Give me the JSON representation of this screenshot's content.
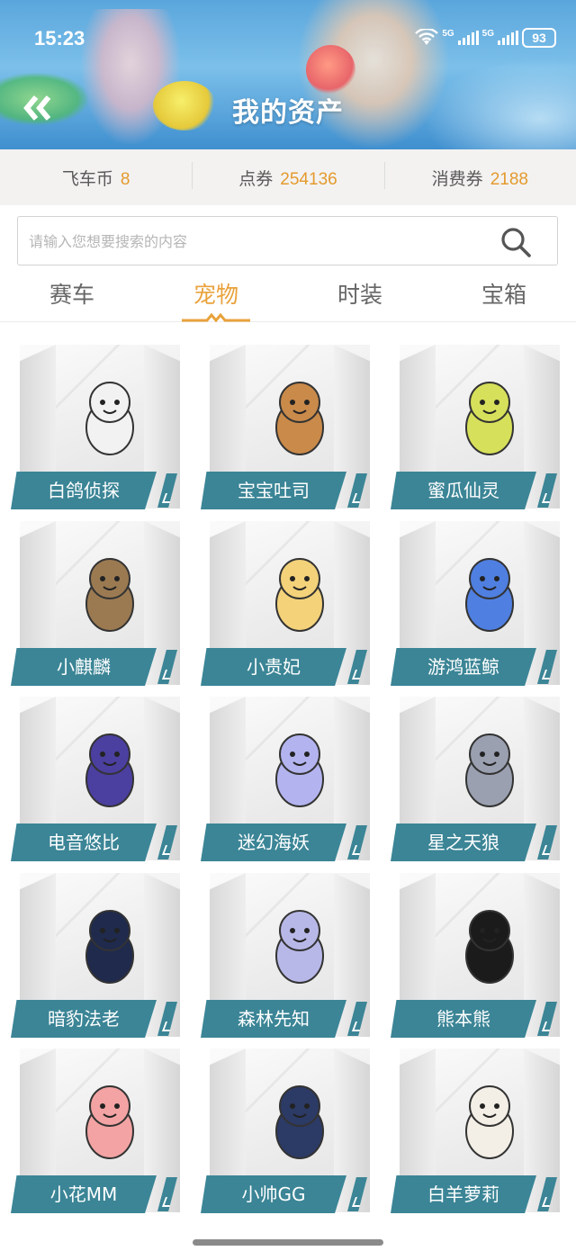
{
  "status_bar": {
    "time": "15:23",
    "network_1": "5G",
    "network_2": "5G",
    "battery": "93"
  },
  "header": {
    "title": "我的资产"
  },
  "balances": [
    {
      "label": "飞车币",
      "value": "8"
    },
    {
      "label": "点券",
      "value": "254136"
    },
    {
      "label": "消费券",
      "value": "2188"
    }
  ],
  "search": {
    "placeholder": "请输入您想要搜索的内容",
    "value": ""
  },
  "tabs": [
    {
      "label": "赛车",
      "active": false
    },
    {
      "label": "宠物",
      "active": true
    },
    {
      "label": "时装",
      "active": false
    },
    {
      "label": "宝箱",
      "active": false
    }
  ],
  "pets": [
    {
      "name": "白鸽侦探",
      "icon": "pigeon-detective-icon",
      "color": "#f2f2f2"
    },
    {
      "name": "宝宝吐司",
      "icon": "toast-cookie-icon",
      "color": "#c98a4a"
    },
    {
      "name": "蜜瓜仙灵",
      "icon": "melon-fairy-icon",
      "color": "#d7e05a"
    },
    {
      "name": "小麒麟",
      "icon": "qilin-icon",
      "color": "#9b7a52"
    },
    {
      "name": "小贵妃",
      "icon": "princess-icon",
      "color": "#f3d27a"
    },
    {
      "name": "游鸿蓝鲸",
      "icon": "blue-whale-icon",
      "color": "#4f7fe0"
    },
    {
      "name": "电音悠比",
      "icon": "yoyo-creature-icon",
      "color": "#4b3fa0"
    },
    {
      "name": "迷幻海妖",
      "icon": "sea-siren-icon",
      "color": "#b3b4ef"
    },
    {
      "name": "星之天狼",
      "icon": "star-wolf-icon",
      "color": "#9aa0b0"
    },
    {
      "name": "暗豹法老",
      "icon": "anubis-icon",
      "color": "#1f2a4d"
    },
    {
      "name": "森林先知",
      "icon": "forest-cat-icon",
      "color": "#b8b8e8"
    },
    {
      "name": "熊本熊",
      "icon": "kumamon-icon",
      "color": "#1b1b1b"
    },
    {
      "name": "小花MM",
      "icon": "flower-girl-icon",
      "color": "#f3a3a3"
    },
    {
      "name": "小帅GG",
      "icon": "baby-boy-icon",
      "color": "#2c3a66"
    },
    {
      "name": "白羊萝莉",
      "icon": "sheep-icon",
      "color": "#f4efe6"
    }
  ]
}
